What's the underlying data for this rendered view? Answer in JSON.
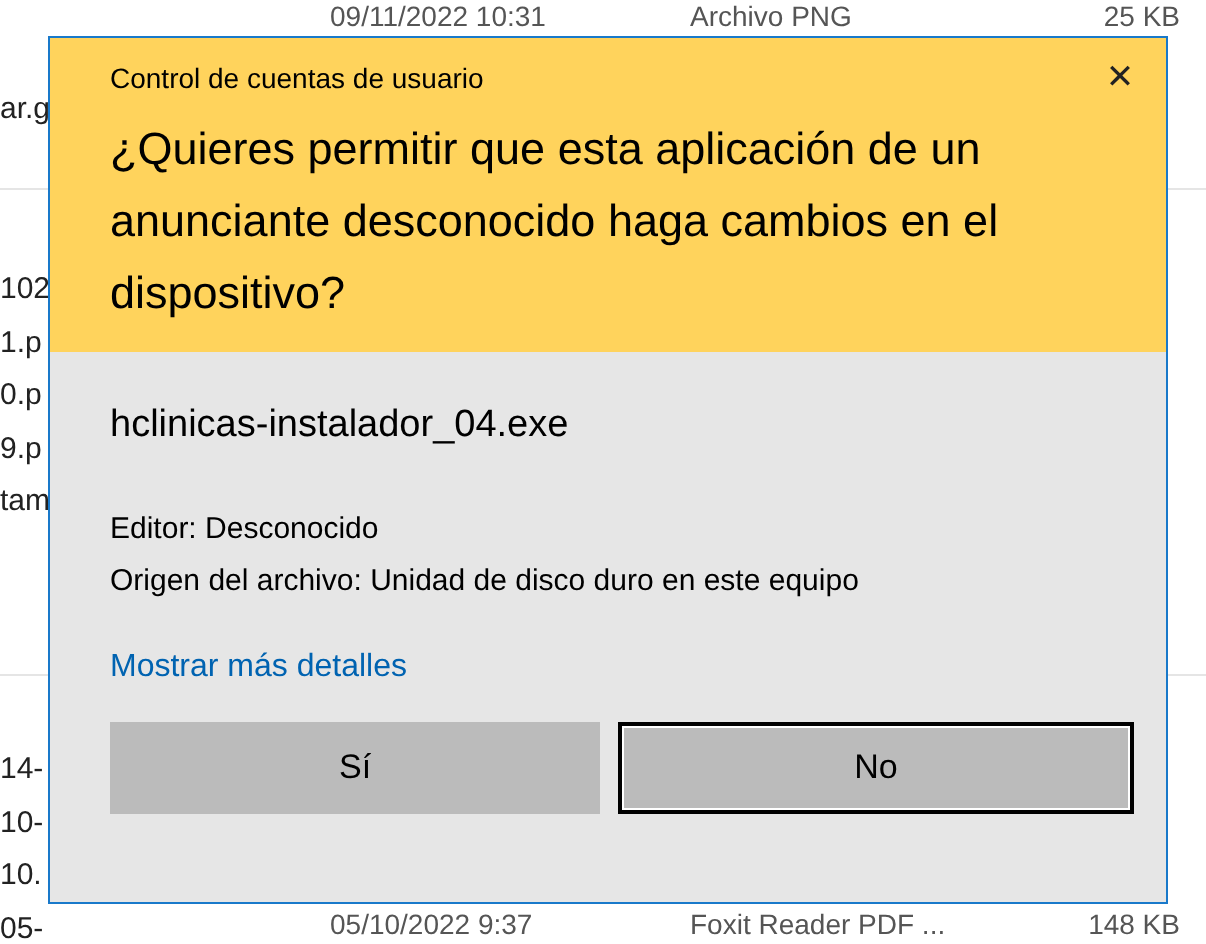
{
  "background": {
    "top_row": {
      "date": "09/11/2022 10:31",
      "type": "Archivo PNG",
      "size": "25 KB"
    },
    "name_fragments": [
      [
        "ar.g"
      ],
      [
        "102",
        "1.p",
        "0.p",
        "9.p",
        "tam"
      ],
      [
        "14-",
        "10-",
        "10.",
        "05-"
      ]
    ],
    "bottom_row": {
      "date": "05/10/2022 9:37",
      "type": "Foxit Reader PDF ...",
      "size": "148 KB"
    }
  },
  "dialog": {
    "title": "Control de cuentas de usuario",
    "close": "✕",
    "question": "¿Quieres permitir que esta aplicación de un anunciante desconocido haga cambios en el dispositivo?",
    "program": "hclinicas-instalador_04.exe",
    "details": [
      "Editor: Desconocido",
      "Origen del archivo: Unidad de disco duro en este equipo"
    ],
    "more_link": "Mostrar más detalles",
    "buttons": [
      {
        "label": "Sí",
        "selected": false
      },
      {
        "label": "No",
        "selected": true
      }
    ]
  }
}
